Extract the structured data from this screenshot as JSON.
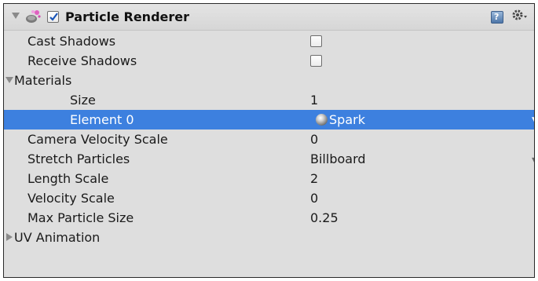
{
  "component": {
    "title": "Particle Renderer",
    "enabled": true
  },
  "properties": {
    "cast_shadows": {
      "label": "Cast Shadows",
      "checked": false
    },
    "receive_shadows": {
      "label": "Receive Shadows",
      "checked": false
    },
    "materials": {
      "label": "Materials",
      "expanded": true,
      "size": {
        "label": "Size",
        "value": "1"
      },
      "element0": {
        "label": "Element 0",
        "value": "Spark"
      }
    },
    "camera_velocity_scale": {
      "label": "Camera Velocity Scale",
      "value": "0"
    },
    "stretch_particles": {
      "label": "Stretch Particles",
      "value": "Billboard"
    },
    "length_scale": {
      "label": "Length Scale",
      "value": "2"
    },
    "velocity_scale": {
      "label": "Velocity Scale",
      "value": "0"
    },
    "max_particle_size": {
      "label": "Max Particle Size",
      "value": "0.25"
    },
    "uv_animation": {
      "label": "UV Animation",
      "expanded": false
    }
  },
  "icons": {
    "component": "particle-renderer-icon",
    "help": "help-icon",
    "settings": "gear-icon"
  },
  "colors": {
    "selection": "#3d80df",
    "panel_bg": "#dedede"
  }
}
